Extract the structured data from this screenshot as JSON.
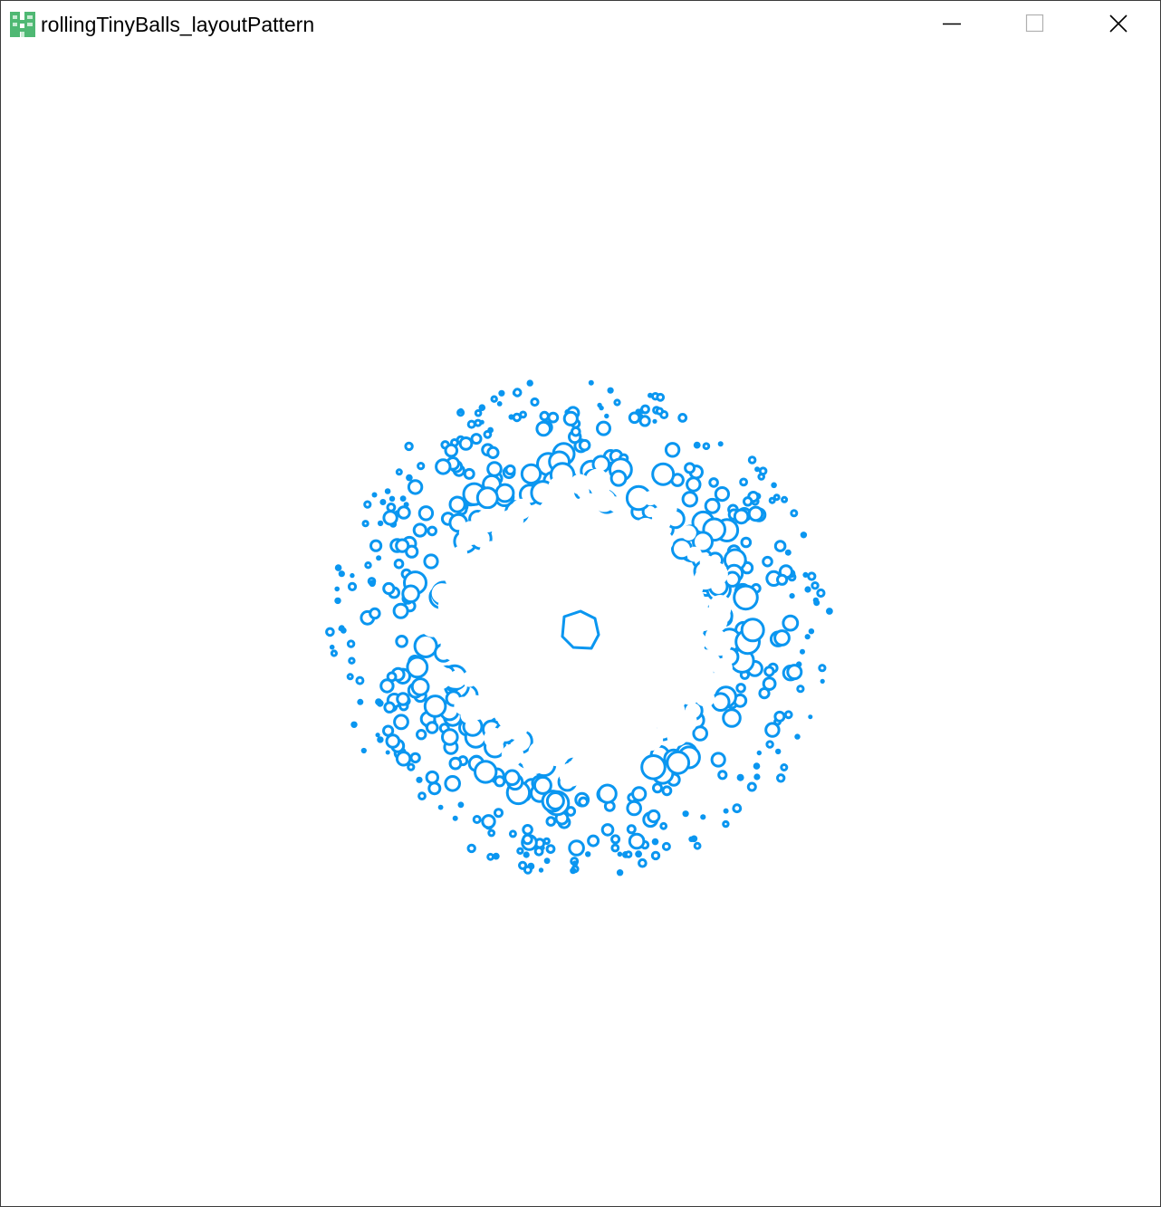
{
  "window": {
    "title": "rollingTinyBalls_layoutPattern",
    "icon": "processing-app-icon",
    "controls": {
      "minimize": "minimize-icon",
      "maximize": "maximize-icon",
      "close": "close-icon"
    }
  },
  "sketch": {
    "background_color": "#ffffff",
    "ball_stroke_color": "#0a96f0",
    "icon_color": "#4fb873"
  }
}
